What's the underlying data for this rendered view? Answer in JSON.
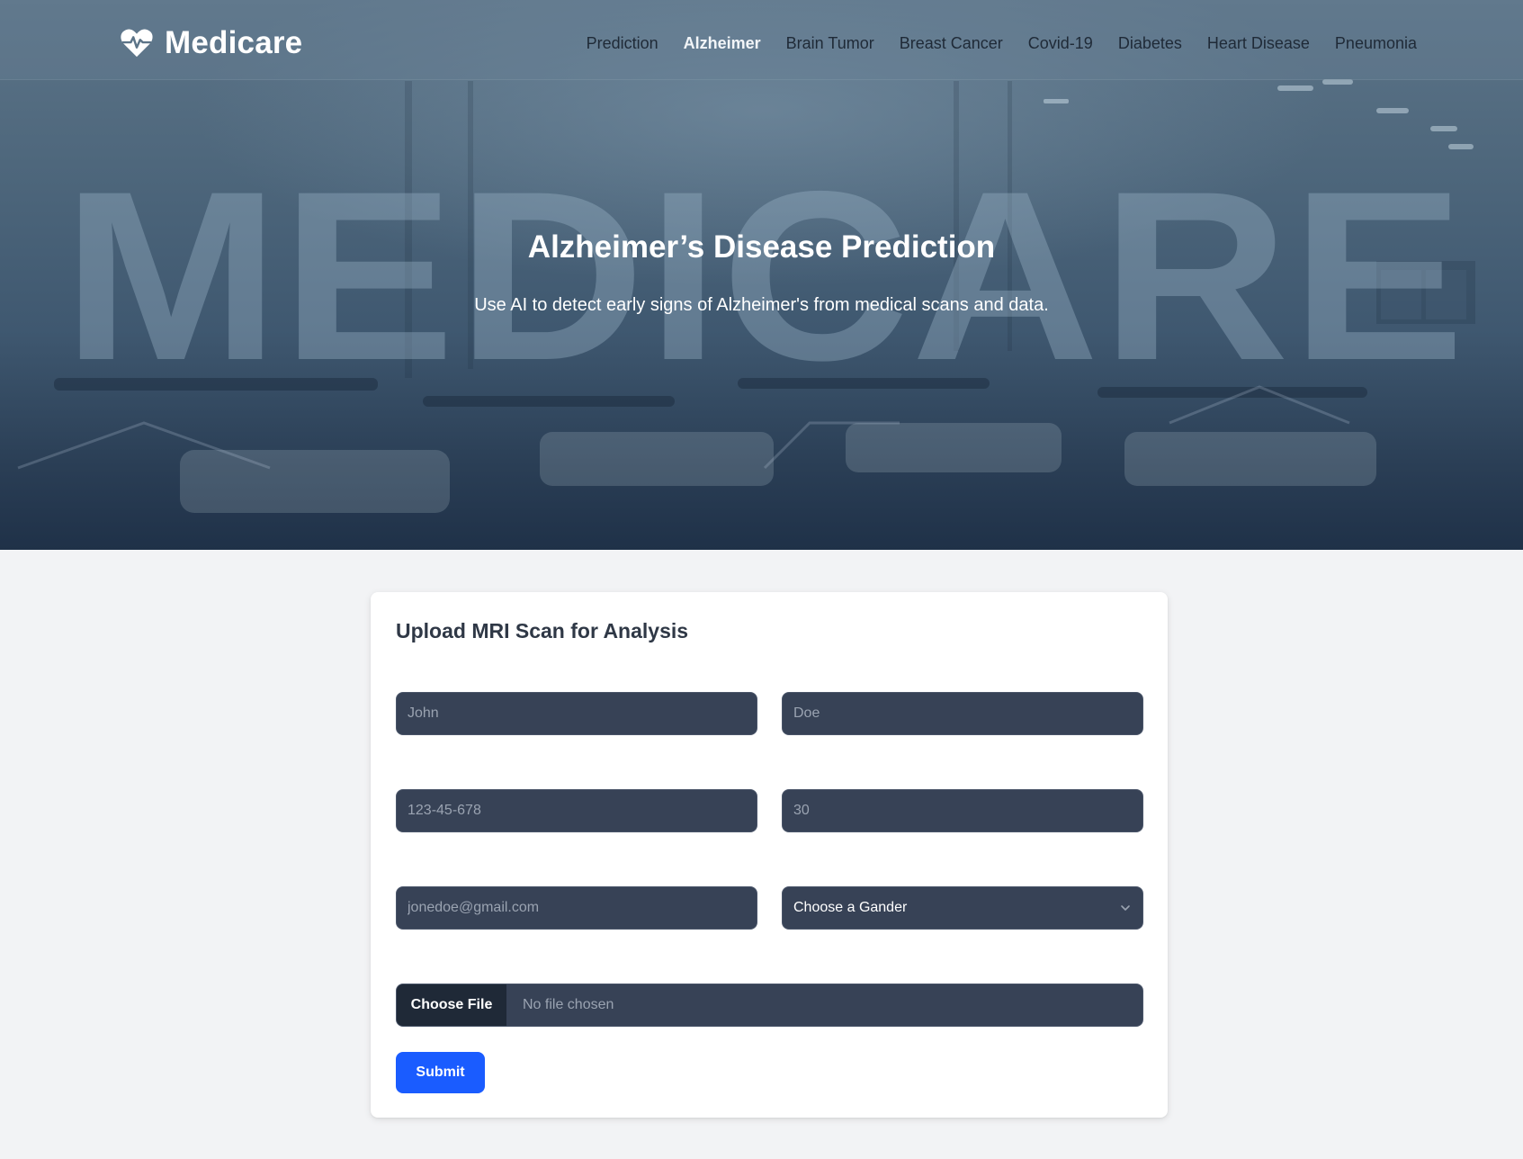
{
  "brand": {
    "name": "Medicare",
    "icon": "heart-pulse-icon"
  },
  "nav": {
    "links": [
      {
        "label": "Prediction"
      },
      {
        "label": "Alzheimer",
        "active": true
      },
      {
        "label": "Brain Tumor"
      },
      {
        "label": "Breast Cancer"
      },
      {
        "label": "Covid-19"
      },
      {
        "label": "Diabetes"
      },
      {
        "label": "Heart Disease"
      },
      {
        "label": "Pneumonia"
      }
    ]
  },
  "hero": {
    "watermark": "MEDICARE",
    "title": "Alzheimer’s Disease Prediction",
    "subtitle": "Use AI to detect early signs of Alzheimer's from medical scans and data."
  },
  "form": {
    "title": "Upload MRI Scan for Analysis",
    "first_name": {
      "placeholder": "John",
      "value": ""
    },
    "last_name": {
      "placeholder": "Doe",
      "value": ""
    },
    "id_number": {
      "placeholder": "123-45-678",
      "value": ""
    },
    "age": {
      "placeholder": "30",
      "value": ""
    },
    "email": {
      "placeholder": "jonedoe@gmail.com",
      "value": ""
    },
    "gender": {
      "selected": "Choose a Gander"
    },
    "file": {
      "button_label": "Choose File",
      "status": "No file chosen"
    },
    "submit_label": "Submit"
  },
  "colors": {
    "navbar_link": "#1f2a37",
    "input_bg": "#374256",
    "submit_bg": "#1a5cff",
    "page_bg": "#f2f3f5"
  }
}
